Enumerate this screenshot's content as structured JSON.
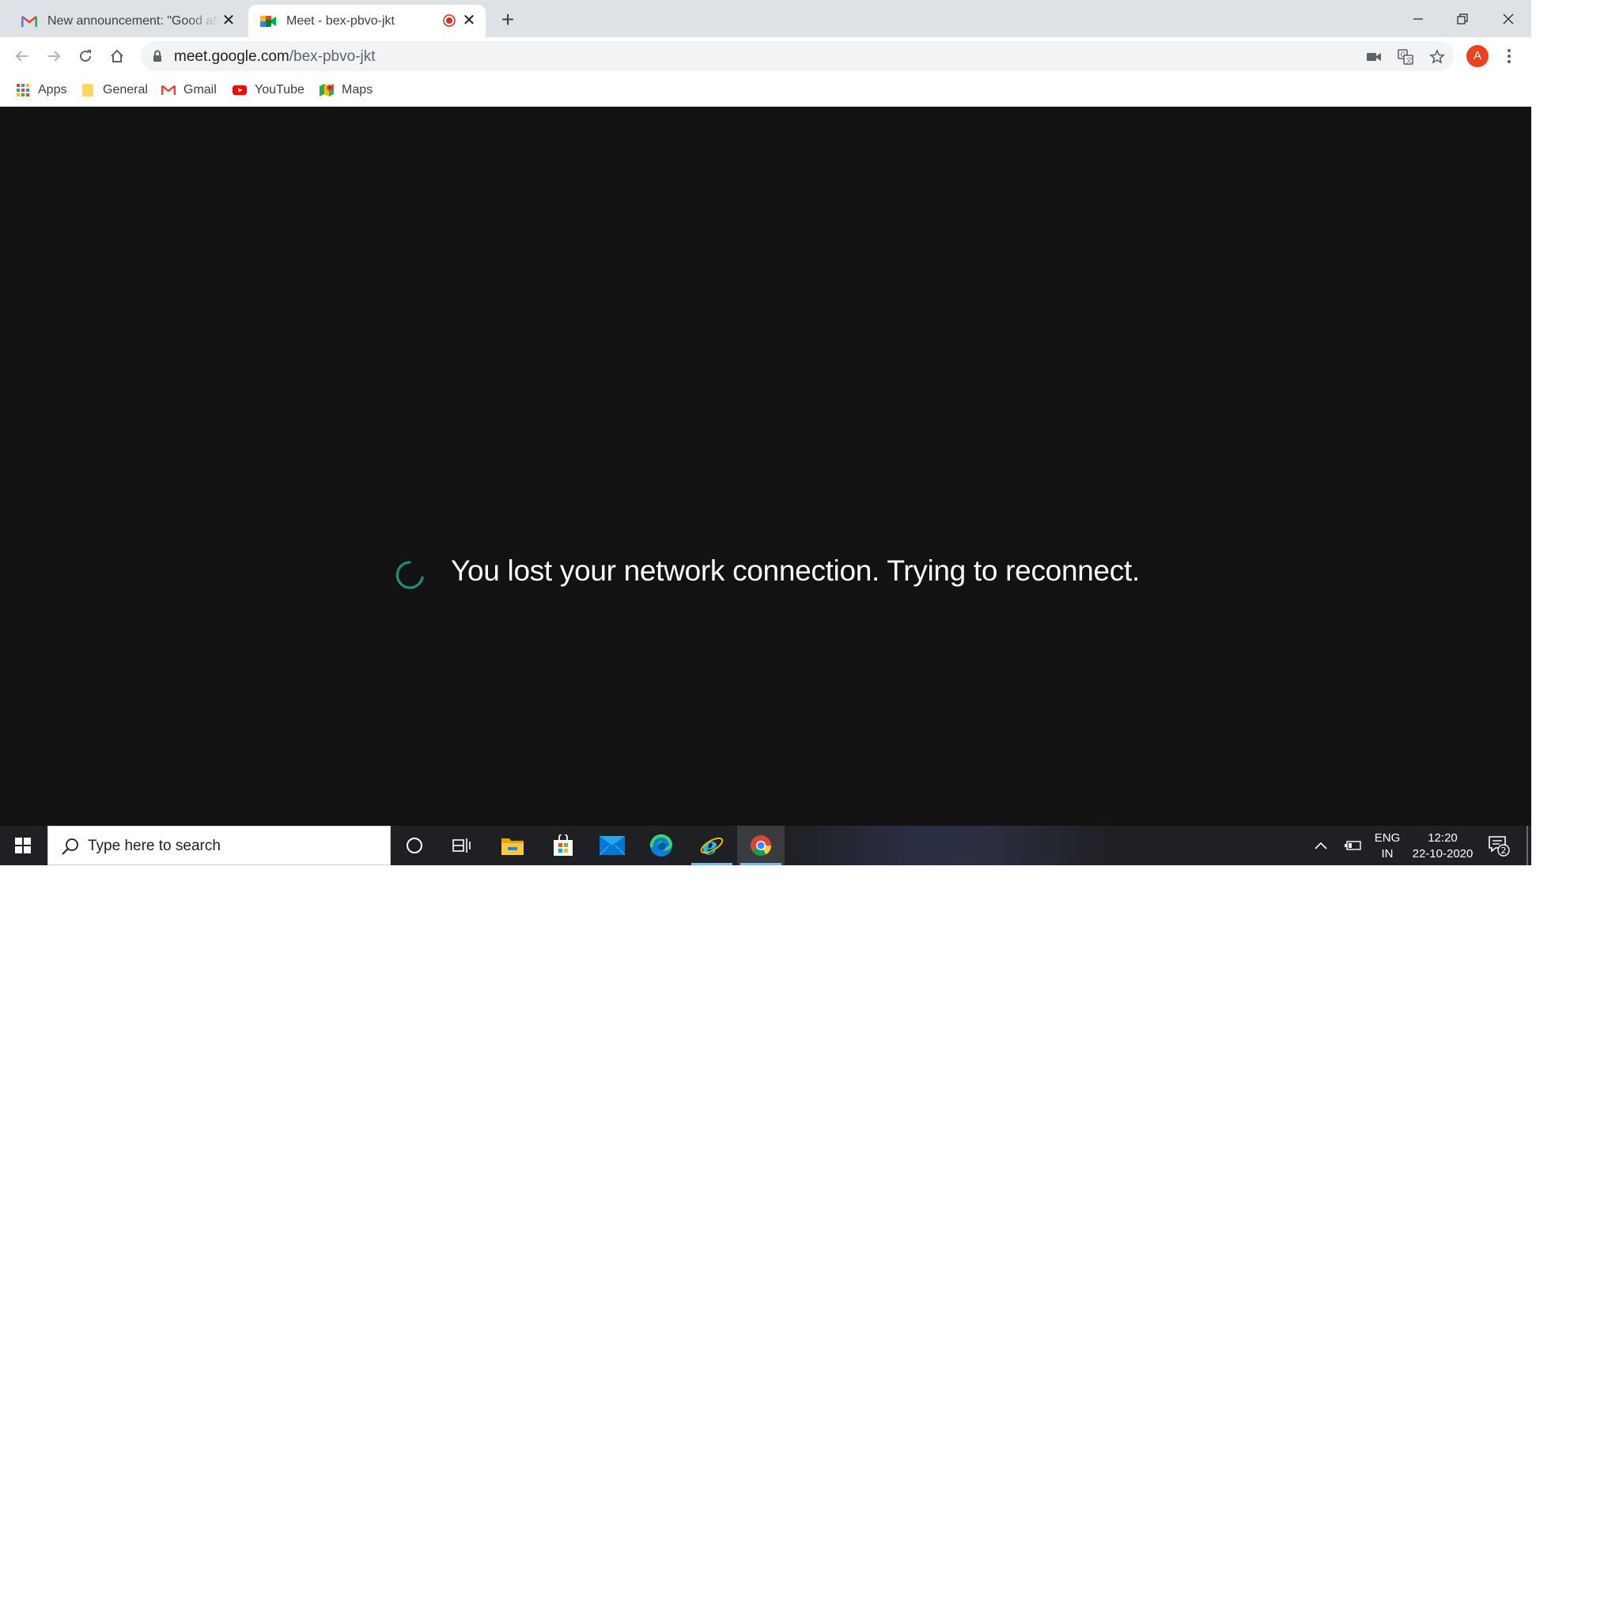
{
  "browser": {
    "tabs": [
      {
        "title": "New announcement: \"Good afternoon\"",
        "favicon": "gmail-icon",
        "active": false
      },
      {
        "title": "Meet - bex-pbvo-jkt",
        "favicon": "meet-icon",
        "active": true,
        "recording_indicator": true
      }
    ],
    "url_host": "meet.google.com",
    "url_path": "/bex-pbvo-jkt",
    "profile_initial": "A",
    "profile_color": "#e8431e",
    "bookmarks": [
      {
        "label": "Apps",
        "icon": "apps-grid-icon"
      },
      {
        "label": "General",
        "icon": "folder-icon"
      },
      {
        "label": "Gmail",
        "icon": "gmail-icon"
      },
      {
        "label": "YouTube",
        "icon": "youtube-icon"
      },
      {
        "label": "Maps",
        "icon": "maps-icon"
      }
    ]
  },
  "meet": {
    "message": "You lost your network connection. Trying to reconnect.",
    "spinner_color": "#1e8e7e",
    "background": "#121212"
  },
  "taskbar": {
    "search_placeholder": "Type here to search",
    "apps": [
      "cortana-icon",
      "task-view-icon",
      "file-explorer-icon",
      "store-icon",
      "mail-icon",
      "edge-icon",
      "internet-explorer-icon",
      "chrome-icon"
    ],
    "lang_line1": "ENG",
    "lang_line2": "IN",
    "time": "12:20",
    "date": "22-10-2020",
    "notification_count": "2"
  }
}
